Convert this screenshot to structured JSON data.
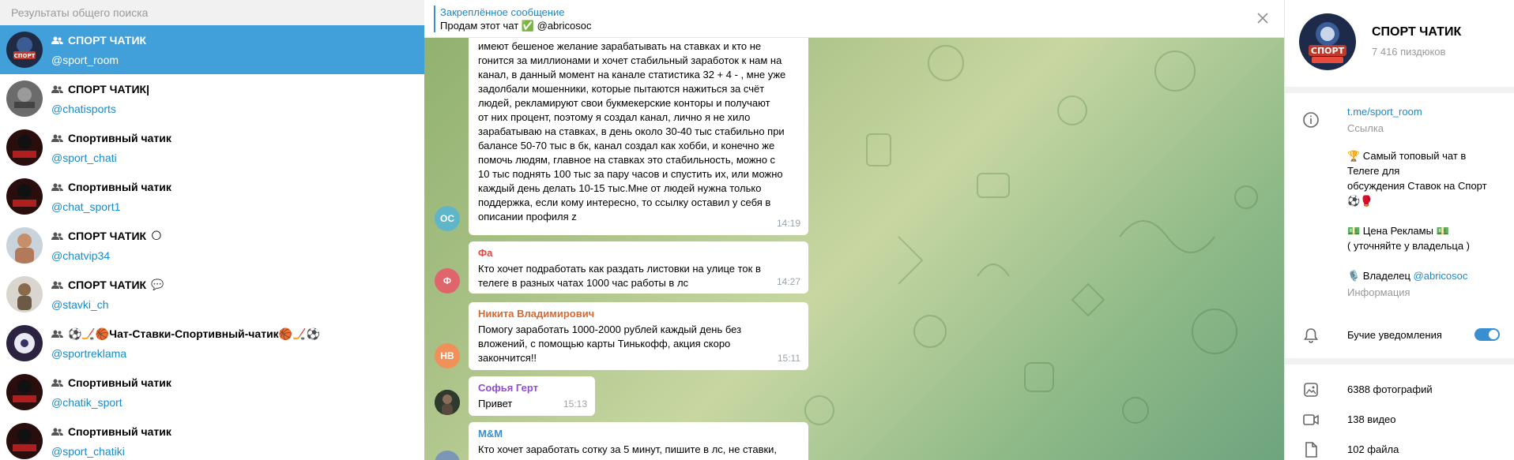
{
  "search": {
    "header": "Результаты общего поиска"
  },
  "results": [
    {
      "title": "СПОРТ ЧАТИК",
      "handle": "@sport_room"
    },
    {
      "title": "СПОРТ ЧАТИК|",
      "handle": "@chatisports"
    },
    {
      "title": "Спортивный чатик",
      "handle": "@sport_chati"
    },
    {
      "title": "Спортивный чатик",
      "handle": "@chat_sport1"
    },
    {
      "title": "СПОРТ ЧАТИК",
      "title_extra": "🌕",
      "handle": "@chatvip34"
    },
    {
      "title": "СПОРТ ЧАТИК",
      "title_extra": "💬",
      "handle": "@stavki_ch"
    },
    {
      "title": "⚽🏒🏀Чат-Ставки-Спортивный-чатик🏀🏒⚽",
      "handle": "@sportreklama"
    },
    {
      "title": "Спортивный чатик",
      "handle": "@chatik_sport"
    },
    {
      "title": "Спортивный чатик",
      "handle": "@sport_chatiki"
    }
  ],
  "pinned": {
    "title": "Закреплённое сообщение",
    "text": "Продам этот чат ✅ @abricosoc"
  },
  "messages": [
    {
      "initials": "ОС",
      "sender": "",
      "text": "Доброе утро дамы и господа ищу адекватных людей, которые\nимеют бешеное желание зарабатывать на ставках и кто не\nгонится за миллионами и хочет стабильный заработок к нам на\nканал, в данный момент на канале статистика 32 + 4 - , мне уже\nзадолбали мошенники, которые пытаются нажиться за счёт\nлюдей, рекламируют свои букмекерские конторы и получают\nот них процент, поэтому я создал канал, лично я не хило\nзарабатываю на ставках, в день около 30-40 тыс стабильно при\nбалансе 50-70 тыс в бк, канал создал как хобби, и конечно же\nпомочь людям, главное на ставках это стабильность, можно с\n10 тыс поднять 100 тыс за пару часов и спустить их, или можно\nкаждый день делать 10-15 тыс.Мне от людей нужна только\nподдержка, если кому интересно, то ссылку оставил у себя в\nописании профиля z",
      "time": "14:19"
    },
    {
      "initials": "Ф",
      "sender": "Фа",
      "text": "Кто хочет подработать как раздать листовки на улице ток в\nтелеге в разных чатах 1000 час работы в лс",
      "time": "14:27"
    },
    {
      "initials": "НВ",
      "sender": "Никита Владимирович",
      "text": "Помогу заработать 1000-2000 рублей каждый день без\nвложений, с помощью карты Тинькофф, акция скоро\nзакончится!!",
      "time": "15:11"
    },
    {
      "initials": "",
      "sender": "Софья Герт",
      "text": "Привет",
      "time": "15:13"
    },
    {
      "initials": "",
      "sender": "M&M",
      "text": "Кто хочет заработать сотку за 5 минут, пишите в лс, не ставки,",
      "time": ""
    }
  ],
  "profile": {
    "name": "СПОРТ ЧАТИК",
    "members": "7 416 пиздюков",
    "link": "t.me/sport_room",
    "link_label": "Ссылка",
    "desc_line1": "🏆 Самый топовый чат в",
    "desc_line2": "Телеге для",
    "desc_line3": "обсуждения Ставок на Спорт",
    "desc_line4": "⚽🥊",
    "desc_line5": "💵 Цена Рекламы 💵",
    "desc_line6": "( уточняйте у владельца )",
    "owner_prefix": "🎙️ Владелец ",
    "owner_handle": "@abricosoc",
    "info_label": "Информация",
    "notifications_label": "Бучие уведомления",
    "photos": "6388 фотографий",
    "videos": "138 видео",
    "files": "102 файла"
  },
  "colors": {
    "accent": "#419fd9",
    "link": "#168acd",
    "sender_fa": "#e0473f",
    "sender_nv": "#d9692e",
    "sender_sg": "#8f4bd4",
    "sender_mm": "#3a8fd0"
  }
}
